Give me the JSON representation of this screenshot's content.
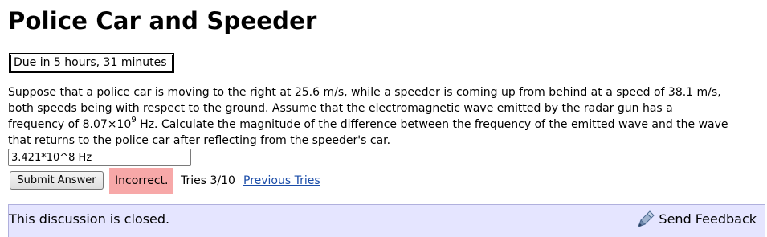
{
  "page": {
    "title": "Police Car and Speeder",
    "due": "Due in 5 hours, 31 minutes"
  },
  "question": {
    "line1": "Suppose that a police car is moving to the right at 25.6 m/s, while a speeder is coming up from behind at a speed of 38.1 m/s,",
    "line2": "both speeds being with respect to the ground. Assume that the electromagnetic wave emitted by the radar gun has a",
    "line3_before": "frequency of 8.07×10",
    "line3_exponent": "9",
    "line3_after": " Hz. Calculate the magnitude of the difference between the frequency of the emitted wave and the wave",
    "line4": "that returns to the police car after reflecting from the speeder's car."
  },
  "answer": {
    "value": "3.421*10^8 Hz"
  },
  "submit": {
    "label": "Submit Answer"
  },
  "status": {
    "text": "Incorrect.",
    "color": "#f7a8a8"
  },
  "tries": {
    "text": "Tries 3/10",
    "link_label": "Previous Tries"
  },
  "discussion": {
    "text": "This discussion is closed.",
    "feedback_label": "Send Feedback",
    "feedback_icon": "feedback-icon",
    "background": "#e5e5ff"
  }
}
